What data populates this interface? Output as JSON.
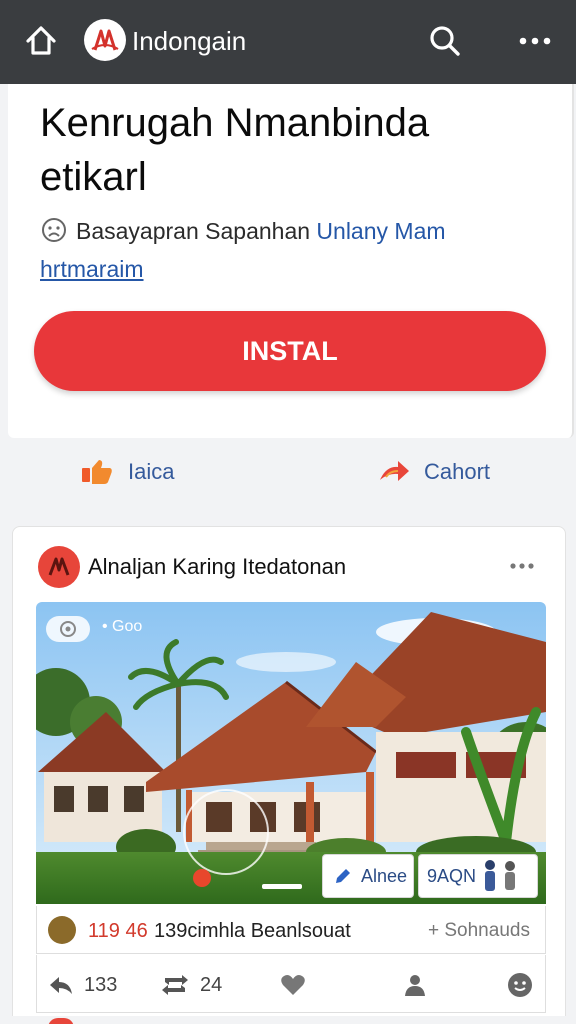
{
  "topbar": {
    "brand": "Indongain"
  },
  "ad": {
    "headline": "Kenrugah Nmanbinda etikarl",
    "sub_text": "Basayapran Sapanhan",
    "sub_link": "Unlany Mam",
    "sub_link2": "hrtmaraim",
    "install_label": "INSTAL"
  },
  "actions": {
    "left_label": "Iaica",
    "right_label": "Cahort"
  },
  "post": {
    "title": "Alnaljan Karing Itedatonan",
    "photo_label": "• Goo",
    "chip1_label": "Alnee",
    "chip2_label": "9AQN",
    "stat_number": "119 46",
    "stat_text": "139cimhla Beanlsouat",
    "stat_right": "+ Sohnauds",
    "bar": {
      "comments": "133",
      "reposts": "24"
    }
  },
  "colors": {
    "topbar": "#3a3d40",
    "accent_red": "#e8373a",
    "link_blue": "#2557a7"
  }
}
